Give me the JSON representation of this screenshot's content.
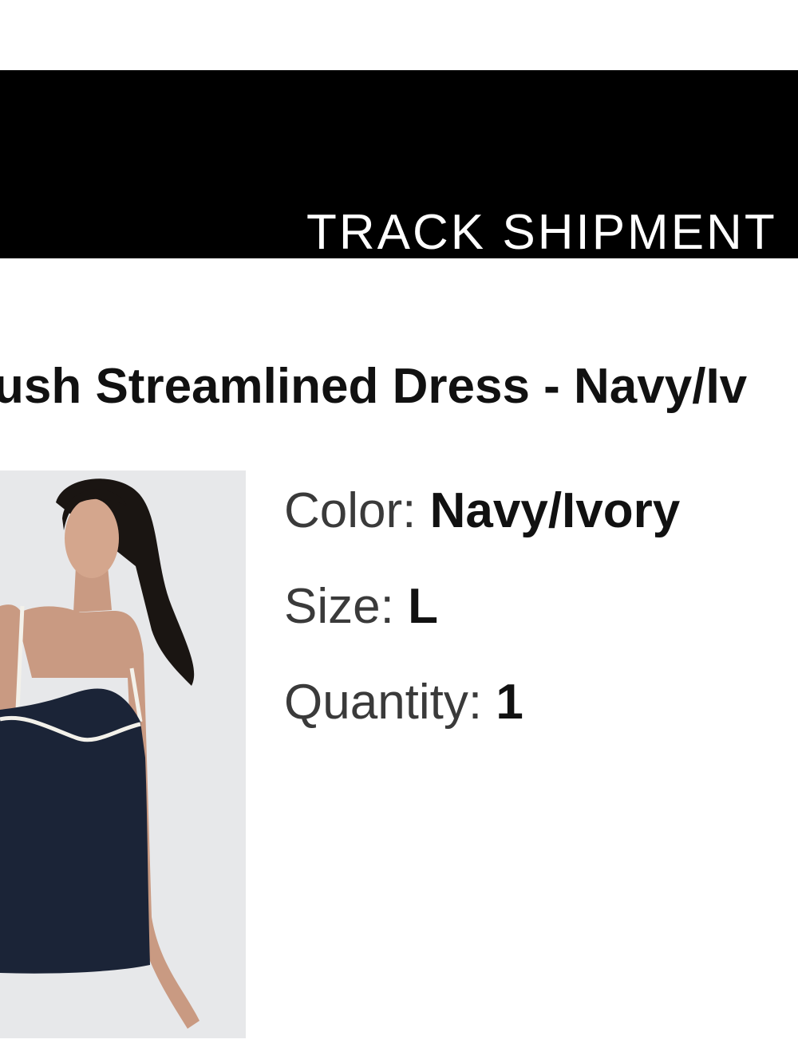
{
  "track_shipment": {
    "label": "TRACK SHIPMENT"
  },
  "product": {
    "title": "ush Streamlined Dress - Navy/Iv",
    "image_icon": "product-photo-dress",
    "color_label": "Color:",
    "color_value": "Navy/Ivory",
    "size_label": "Size:",
    "size_value": "L",
    "quantity_label": "Quantity:",
    "quantity_value": "1"
  },
  "colors": {
    "button_bg": "#000000",
    "button_text": "#ffffff",
    "dress_navy": "#1b2437",
    "trim_ivory": "#f3f1ea",
    "photo_bg": "#e7e8ea"
  }
}
